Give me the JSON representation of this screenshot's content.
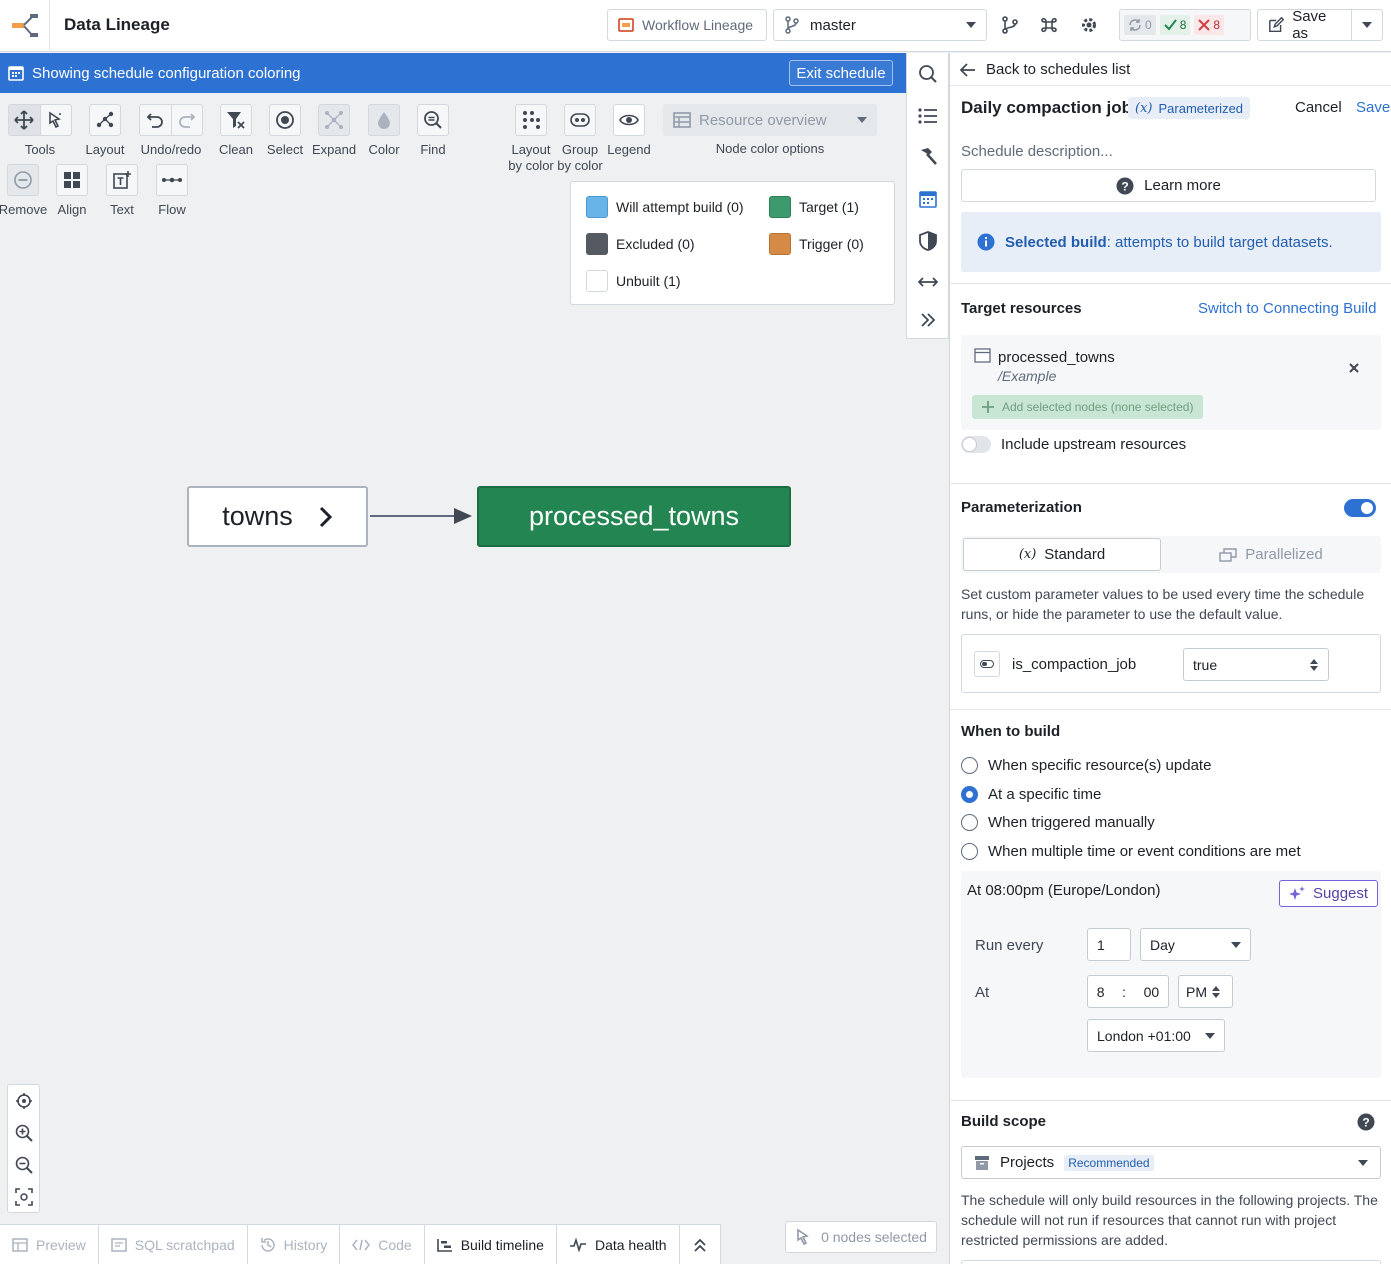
{
  "header": {
    "title": "Data Lineage",
    "workflow_label": "Workflow Lineage",
    "branch": "master",
    "status_sync": "0",
    "status_success": "8",
    "status_fail": "8",
    "save_as_label": "Save as"
  },
  "banner": {
    "text": "Showing schedule configuration coloring",
    "exit_label": "Exit schedule"
  },
  "toolbar": {
    "tools": "Tools",
    "layout": "Layout",
    "undo_redo": "Undo/redo",
    "clean": "Clean",
    "select": "Select",
    "expand": "Expand",
    "color": "Color",
    "find": "Find",
    "layout_by_color": "Layout\nby color",
    "group_by_color": "Group\nby color",
    "legend": "Legend",
    "remove": "Remove",
    "align": "Align",
    "text": "Text",
    "flow": "Flow",
    "node_color_select": "Resource overview",
    "node_color_label": "Node color options"
  },
  "legend": {
    "will_attempt": "Will attempt build (0)",
    "target": "Target (1)",
    "excluded": "Excluded (0)",
    "trigger": "Trigger (0)",
    "unbuilt": "Unbuilt (1)",
    "colors": {
      "will_attempt": "#68b4e8",
      "target": "#3d9a6c",
      "excluded": "#555a62",
      "trigger": "#d58b45",
      "unbuilt": "#ffffff"
    }
  },
  "graph": {
    "source_node": "towns",
    "target_node": "processed_towns"
  },
  "bottom": {
    "tabs": [
      "Preview",
      "SQL scratchpad",
      "History",
      "Code",
      "Build timeline",
      "Data health"
    ],
    "nodes_selected": "0 nodes selected"
  },
  "panel": {
    "back_label": "Back to schedules list",
    "schedule_name": "Daily compaction job",
    "param_badge": "Parameterized",
    "cancel_label": "Cancel",
    "save_label": "Save",
    "description_placeholder": "Schedule description...",
    "learn_more": "Learn more",
    "info_bold": "Selected build",
    "info_rest": ": attempts to build target datasets.",
    "target_resources_title": "Target resources",
    "switch_link": "Switch to Connecting Build",
    "resource_name": "processed_towns",
    "resource_path": "/Example",
    "add_selected": "Add selected nodes (none selected)",
    "include_upstream": "Include upstream resources",
    "parameterization_title": "Parameterization",
    "standard_tab": "Standard",
    "parallelized_tab": "Parallelized",
    "param_help": "Set custom parameter values to be used every time the schedule runs, or hide the parameter to use the default value.",
    "param_name": "is_compaction_job",
    "param_value": "true",
    "when_title": "When to build",
    "radio_options": [
      "When specific resource(s) update",
      "At a specific time",
      "When triggered manually",
      "When multiple time or event conditions are met"
    ],
    "radio_selected_index": 1,
    "time_summary": "At 08:00pm (Europe/London)",
    "suggest_label": "Suggest",
    "run_every_label": "Run every",
    "run_every_value": "1",
    "run_every_unit": "Day",
    "at_label": "At",
    "hour": "8",
    "minute": "00",
    "ampm": "PM",
    "timezone": "London +01:00",
    "build_scope_title": "Build scope",
    "scope_select": "Projects",
    "recommended_badge": "Recommended",
    "scope_help": "The schedule will only build resources in the following projects. The schedule will not run if resources that cannot run with project restricted permissions are added."
  }
}
